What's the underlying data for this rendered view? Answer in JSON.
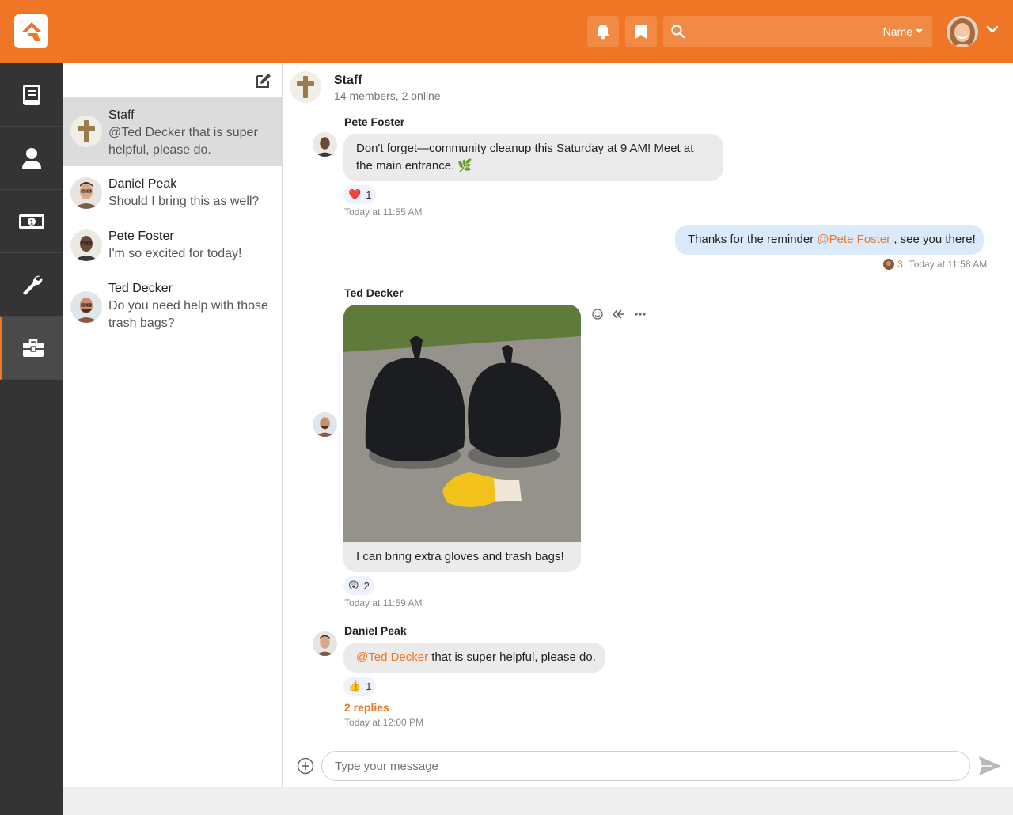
{
  "topbar": {
    "search_placeholder": "",
    "search_filter_label": "Name",
    "icons": [
      "logo-icon",
      "bell-icon",
      "bookmark-icon",
      "search-icon",
      "chevron-down-icon"
    ]
  },
  "leftnav": {
    "items": [
      {
        "icon": "book-icon"
      },
      {
        "icon": "person-icon"
      },
      {
        "icon": "money-icon"
      },
      {
        "icon": "wrench-icon"
      },
      {
        "icon": "briefcase-icon",
        "active": true
      }
    ]
  },
  "conversations": [
    {
      "name": "Staff",
      "message": "@Ted Decker that is super helpful, please do.",
      "active": true
    },
    {
      "name": "Daniel Peak",
      "message": "Should I bring this as well?"
    },
    {
      "name": "Pete Foster",
      "message": "I'm so excited for today!"
    },
    {
      "name": "Ted Decker",
      "message": "Do you need help with those trash bags?"
    }
  ],
  "channel": {
    "title": "Staff",
    "subtitle": "14 members, 2 online"
  },
  "messages": {
    "m1": {
      "sender": "Pete Foster",
      "text": "Don't forget—community cleanup this Saturday at 9 AM! Meet at the main entrance. 🌿",
      "reaction_emoji": "❤️",
      "reaction_count": "1",
      "time": "Today at 11:55 AM"
    },
    "m2": {
      "pre": "Thanks for the reminder ",
      "mention": "@Pete Foster",
      "post": " , see you there!",
      "read_count": "3",
      "time": "Today at 11:58 AM"
    },
    "m3": {
      "sender": "Ted Decker",
      "caption": "I can bring extra gloves and trash bags!",
      "reaction_emoji": "😲",
      "reaction_count": "2",
      "time": "Today at 11:59 AM"
    },
    "m4": {
      "sender": "Daniel Peak",
      "mention": "@Ted Decker",
      "text": " that is super helpful, please do.",
      "reaction_emoji": "👍",
      "reaction_count": "1",
      "replies": "2 replies",
      "time": "Today at 12:00 PM"
    }
  },
  "composer": {
    "placeholder": "Type your message"
  },
  "colors": {
    "brand": "#ee7625",
    "nav_bg": "#343434",
    "bubble": "#ebebeb",
    "bubble_mine": "#dbeafa"
  }
}
